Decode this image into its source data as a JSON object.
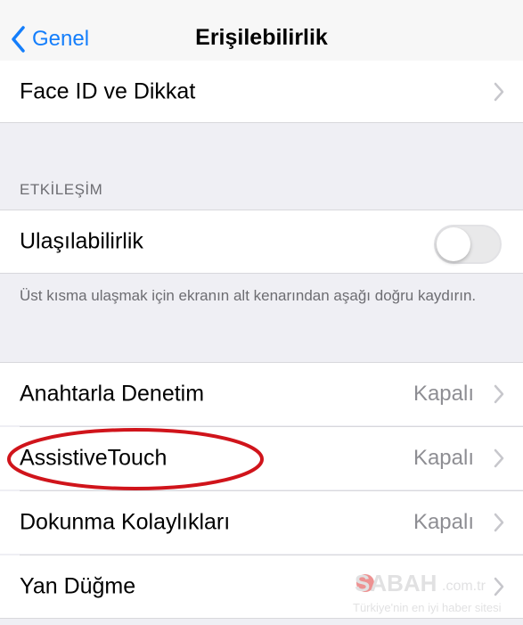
{
  "nav": {
    "back_label": "Genel",
    "title": "Erişilebilirlik"
  },
  "rows_top": {
    "face_id": {
      "label": "Face ID ve Dikkat"
    }
  },
  "section_interaction": {
    "header": "ETKİLEŞİM",
    "reachability": {
      "label": "Ulaşılabilirlik",
      "enabled": false
    },
    "footer": "Üst kısma ulaşmak için ekranın alt kenarından aşağı doğru kaydırın."
  },
  "rows": [
    {
      "label": "Anahtarla Denetim",
      "value": "Kapalı"
    },
    {
      "label": "AssistiveTouch",
      "value": "Kapalı"
    },
    {
      "label": "Dokunma Kolaylıkları",
      "value": "Kapalı"
    },
    {
      "label": "Yan Düğme",
      "value": ""
    }
  ],
  "annotation": {
    "highlighted_row": "AssistiveTouch",
    "color": "#d0141b"
  },
  "watermark": {
    "brand": "SABAH",
    "domain": ".com.tr",
    "tagline": "Türkiye'nin en iyi haber sitesi"
  },
  "colors": {
    "accent": "#147efb",
    "background": "#efeff4",
    "secondary_text": "#8e8e93"
  }
}
